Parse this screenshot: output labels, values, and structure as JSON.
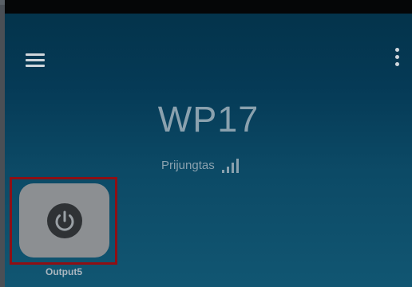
{
  "device": {
    "title": "WP17",
    "connection_status": "Prijungtas"
  },
  "icons": {
    "menu": "hamburger-menu-icon",
    "more": "more-vertical-icon",
    "signal": "signal-strength-icon",
    "power": "power-icon"
  },
  "outputs": [
    {
      "label": "Output5",
      "highlighted": true
    }
  ],
  "colors": {
    "background": "#053a56",
    "text_muted": "#8aa1ae",
    "tile": "#8c8f92",
    "highlight_border": "#8e0f14"
  }
}
